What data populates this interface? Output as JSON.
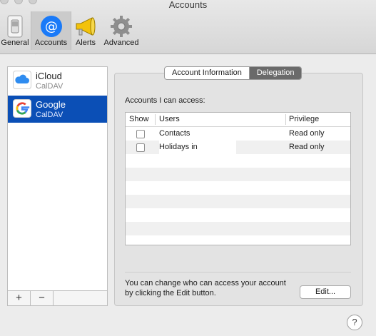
{
  "window": {
    "title": "Accounts"
  },
  "toolbar": {
    "items": [
      {
        "label": "General",
        "icon": "switch-icon"
      },
      {
        "label": "Accounts",
        "icon": "at-sign-icon"
      },
      {
        "label": "Alerts",
        "icon": "megaphone-icon"
      },
      {
        "label": "Advanced",
        "icon": "gear-icon"
      }
    ],
    "selected": "Accounts"
  },
  "sidebar": {
    "accounts": [
      {
        "name": "iCloud",
        "type": "CalDAV",
        "icon": "cloud-icon"
      },
      {
        "name": "Google",
        "type": "CalDAV",
        "icon": "google-icon"
      }
    ],
    "selected": "Google",
    "footer": {
      "add": "+",
      "remove": "−"
    }
  },
  "tabs": {
    "items": [
      "Account Information",
      "Delegation"
    ],
    "active": "Delegation"
  },
  "delegation": {
    "access_label": "Accounts I can access:",
    "columns": [
      "Show",
      "Users",
      "Privilege"
    ],
    "rows": [
      {
        "show": false,
        "user": "Contacts",
        "privilege": "Read only"
      },
      {
        "show": false,
        "user": "Holidays in",
        "privilege": "Read only"
      }
    ],
    "help_text": "You can change who can access your account by clicking the Edit button.",
    "edit_label": "Edit..."
  },
  "help_button": "?",
  "colors": {
    "selection": "#0b4fb6",
    "accounts_icon": "#1a7af8",
    "alerts_icon": "#f3c20a"
  }
}
